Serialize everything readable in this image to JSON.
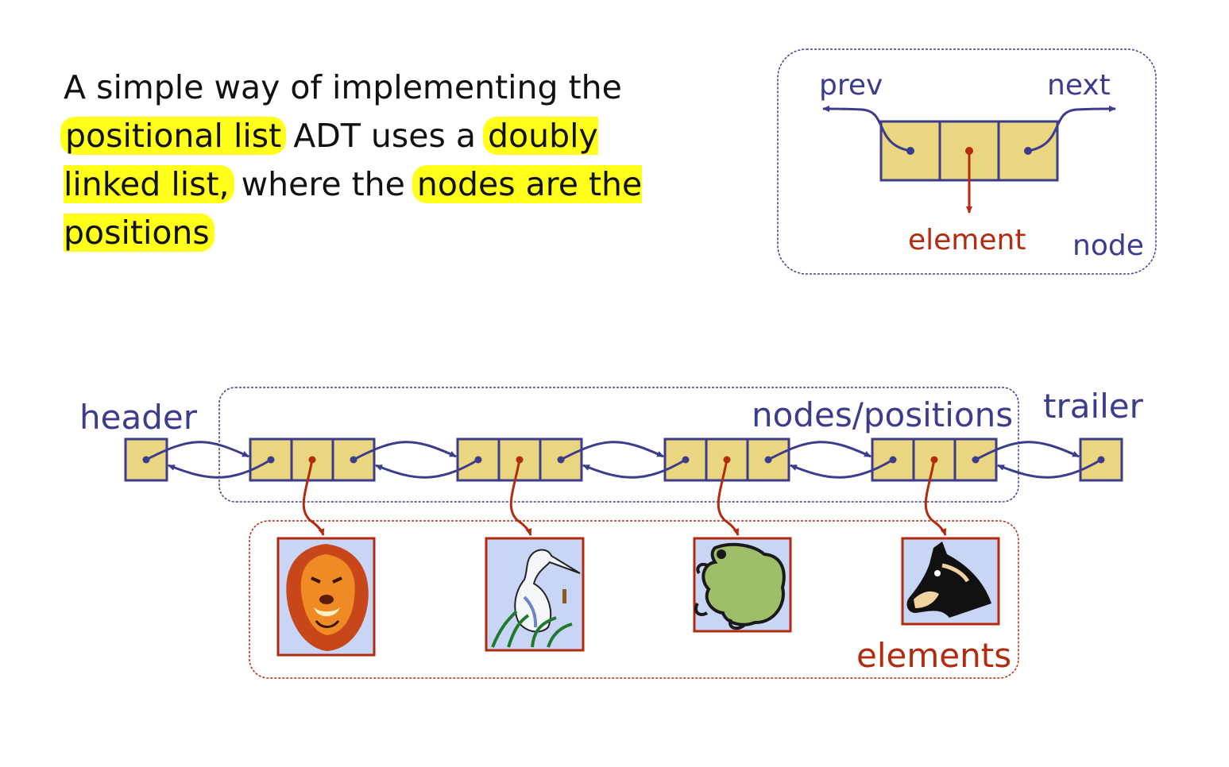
{
  "description": {
    "segments": [
      {
        "text": "A simple way of implementing the ",
        "highlight": false
      },
      {
        "text": "positional list",
        "highlight": true
      },
      {
        "text": " ADT uses a ",
        "highlight": false
      },
      {
        "text": "doubly linked list,",
        "highlight": true
      },
      {
        "text": " where the ",
        "highlight": false
      },
      {
        "text": "nodes are the positions",
        "highlight": true
      }
    ]
  },
  "node_diagram": {
    "prev_label": "prev",
    "next_label": "next",
    "element_label": "element",
    "node_label": "node"
  },
  "list_diagram": {
    "header_label": "header",
    "trailer_label": "trailer",
    "positions_label": "nodes/positions",
    "elements_label": "elements",
    "elements": [
      {
        "icon": "lion-icon"
      },
      {
        "icon": "heron-icon"
      },
      {
        "icon": "frog-icon"
      },
      {
        "icon": "horse-icon"
      }
    ]
  },
  "colors": {
    "node_fill": "#ead580",
    "node_stroke": "#3c3c8c",
    "element_stroke": "#b22b0f",
    "highlight": "#ffff1a",
    "picture_bg": "#c9d5f5"
  }
}
